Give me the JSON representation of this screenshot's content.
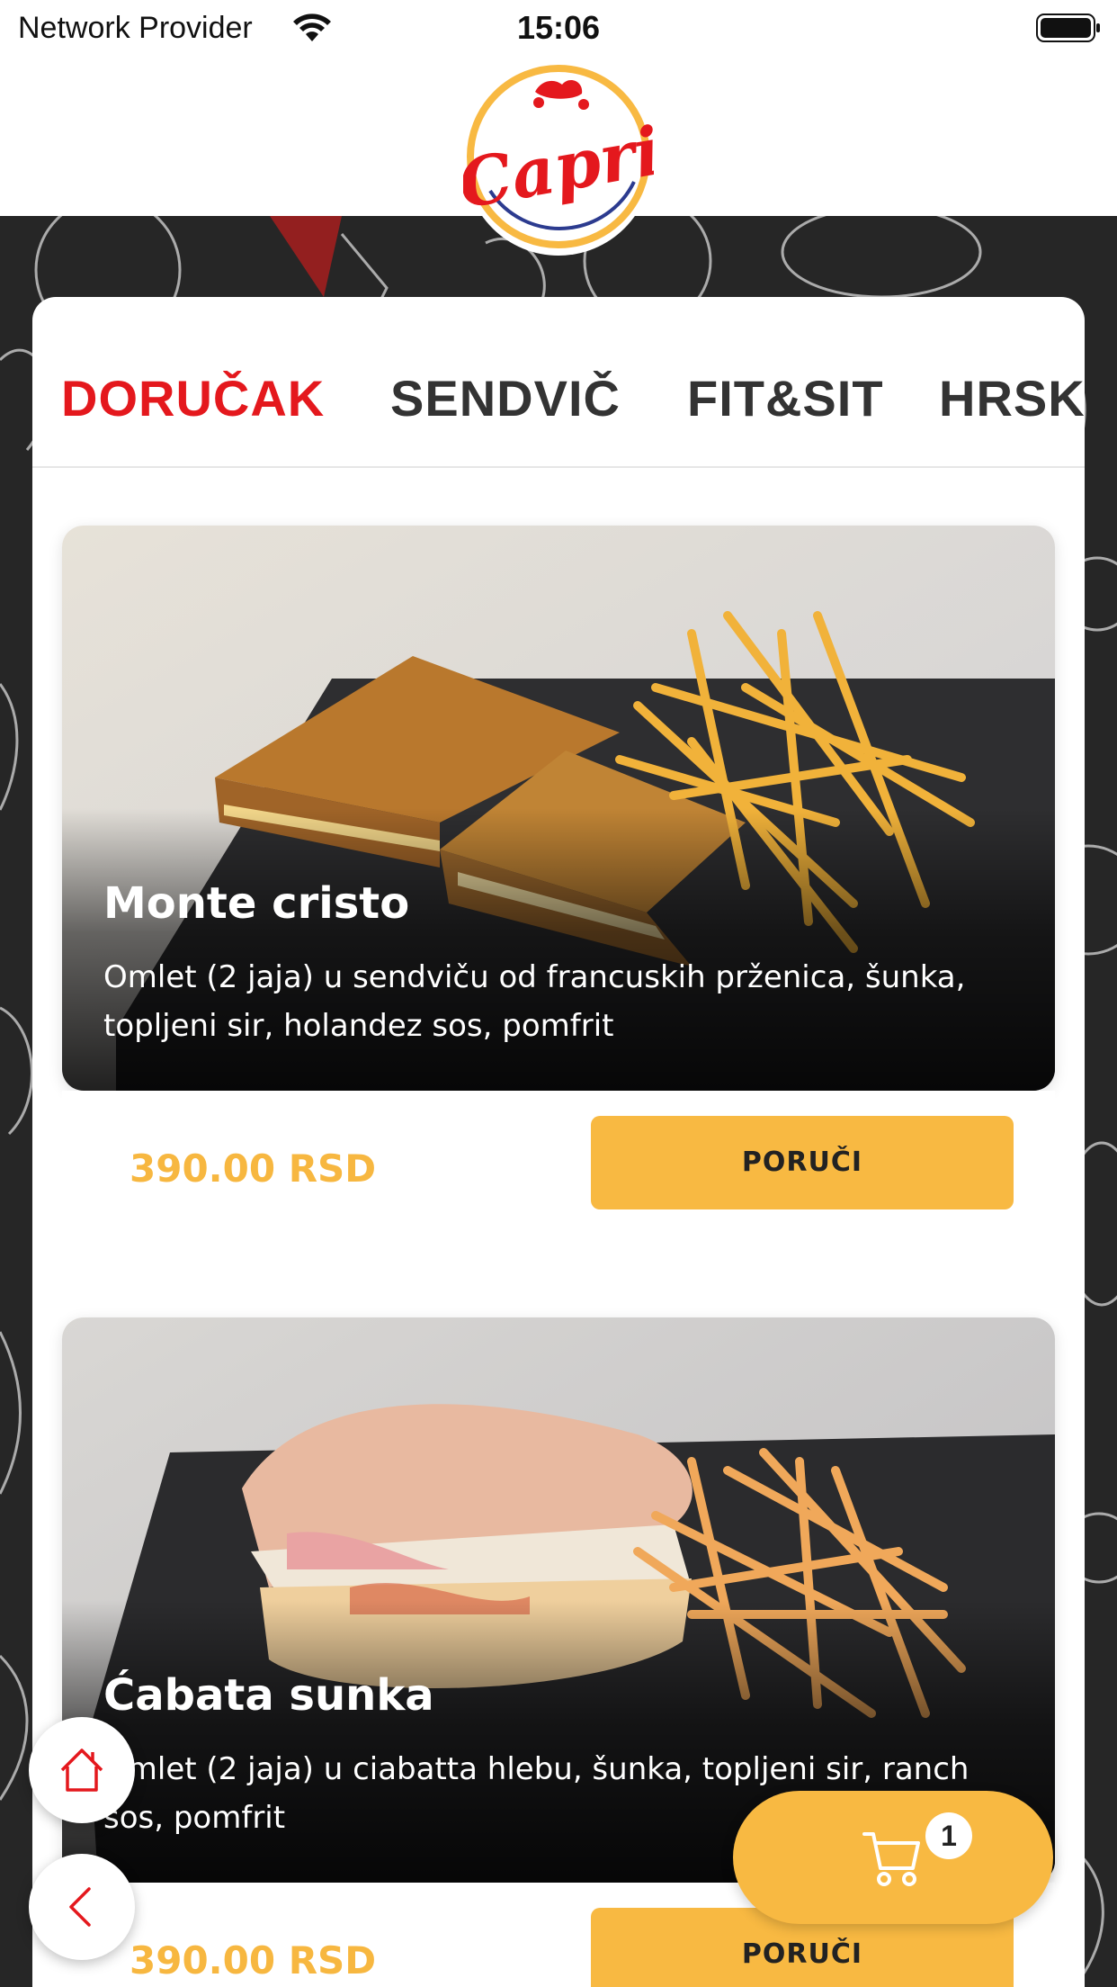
{
  "status_bar": {
    "carrier": "Network Provider",
    "time": "15:06"
  },
  "header": {
    "logo_text": "Capri"
  },
  "tabs": [
    {
      "label": "DORUČAK",
      "active": true
    },
    {
      "label": "SENDVIČ",
      "active": false
    },
    {
      "label": "FIT&SIT",
      "active": false
    },
    {
      "label": "HRSK",
      "active": false
    }
  ],
  "products": [
    {
      "name": "Monte cristo",
      "description": "Omlet (2 jaja) u sendviču od francuskih prženica, šunka, topljeni sir, holandez sos, pomfrit",
      "price": "390.00 RSD",
      "order_label": "PORUČI"
    },
    {
      "name": "Ćabata sunka",
      "description": "Omlet (2 jaja) u ciabatta hlebu, šunka, topljeni sir, ranch sos, pomfrit",
      "price": "390.00 RSD",
      "order_label": "PORUČI"
    }
  ],
  "cart": {
    "count": "1"
  },
  "icons": {
    "home": "home-icon",
    "back": "chevron-left-icon",
    "cart": "cart-icon",
    "wifi": "wifi-icon",
    "battery": "battery-icon"
  },
  "colors": {
    "accent_red": "#e4181d",
    "accent_yellow": "#f8b942",
    "price_color": "#f7b740"
  }
}
